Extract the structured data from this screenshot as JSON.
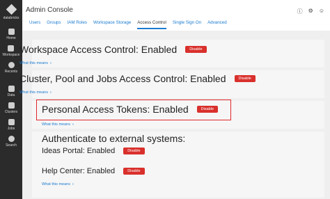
{
  "sidebar": {
    "brand": "databricks",
    "items": [
      {
        "label": "Home",
        "icon": "home-icon"
      },
      {
        "label": "Workspace",
        "icon": "folder-icon"
      },
      {
        "label": "Recents",
        "icon": "clock-icon"
      },
      {
        "label": "Data",
        "icon": "database-icon"
      },
      {
        "label": "Clusters",
        "icon": "cloud-icon"
      },
      {
        "label": "Jobs",
        "icon": "calendar-icon"
      },
      {
        "label": "Search",
        "icon": "search-icon"
      }
    ]
  },
  "header": {
    "title": "Admin Console",
    "icons": [
      "help-icon",
      "gear-icon",
      "user-icon"
    ],
    "tabs": [
      "Users",
      "Groups",
      "IAM Roles",
      "Workspace Storage",
      "Access Control",
      "Single Sign On",
      "Advanced"
    ],
    "active_tab": "Access Control"
  },
  "settings": {
    "workspace_access": {
      "label": "Workspace Access Control: Enabled",
      "button": "Disable",
      "link": "What this means"
    },
    "cluster_jobs_access": {
      "label": "Cluster, Pool and Jobs Access Control: Enabled",
      "button": "Disable",
      "link": "What this means"
    },
    "personal_tokens": {
      "label": "Personal Access Tokens: Enabled",
      "button": "Disable",
      "link": "What this means"
    },
    "external_auth": {
      "heading": "Authenticate to external systems:",
      "ideas_portal": {
        "label": "Ideas Portal: Enabled",
        "button": "Disable"
      },
      "help_center": {
        "label": "Help Center: Enabled",
        "button": "Disable"
      },
      "link": "What this means"
    }
  },
  "colors": {
    "accent": "#1b7bd0",
    "danger": "#d9302c",
    "sidebar": "#2b2b2b"
  }
}
